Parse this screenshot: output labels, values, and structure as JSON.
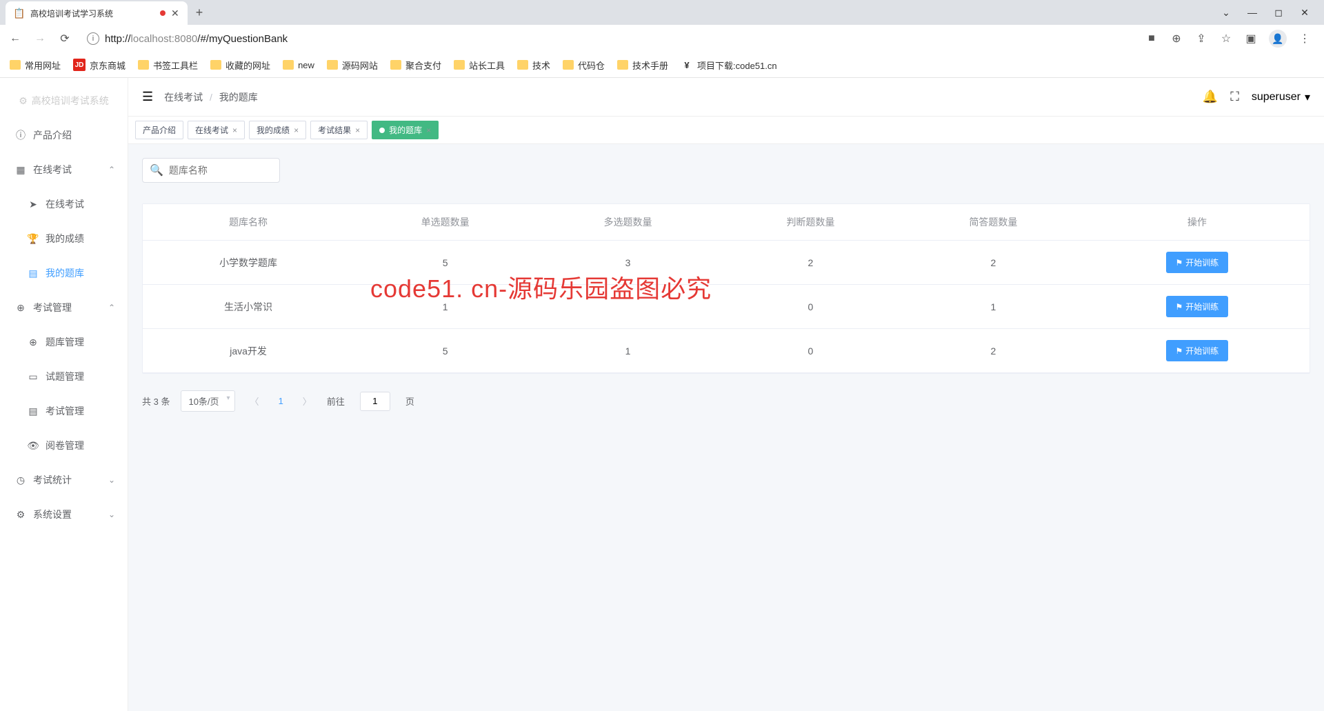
{
  "browser": {
    "tab_title": "高校培训考试学习系统",
    "url_host": "localhost",
    "url_port": ":8080",
    "url_path": "/#/myQuestionBank",
    "url_display_prefix": "http://"
  },
  "bookmarks": [
    {
      "label": "常用网址",
      "type": "folder"
    },
    {
      "label": "京东商城",
      "type": "jd"
    },
    {
      "label": "书签工具栏",
      "type": "folder"
    },
    {
      "label": "收藏的网址",
      "type": "folder"
    },
    {
      "label": "new",
      "type": "folder"
    },
    {
      "label": "源码网站",
      "type": "folder"
    },
    {
      "label": "聚合支付",
      "type": "folder"
    },
    {
      "label": "站长工具",
      "type": "folder"
    },
    {
      "label": "技术",
      "type": "folder"
    },
    {
      "label": "代码仓",
      "type": "folder"
    },
    {
      "label": "技术手册",
      "type": "folder"
    },
    {
      "label": "项目下载:code51.cn",
      "type": "yen"
    }
  ],
  "sidebar": {
    "logo": "高校培训考试系统",
    "items": [
      {
        "label": "产品介绍",
        "icon": "ⓘ"
      },
      {
        "label": "在线考试",
        "icon": "▦",
        "expandable": true,
        "open": true,
        "children": [
          {
            "label": "在线考试",
            "icon": "➤"
          },
          {
            "label": "我的成绩",
            "icon": "🏆"
          },
          {
            "label": "我的题库",
            "icon": "▤",
            "active": true
          }
        ]
      },
      {
        "label": "考试管理",
        "icon": "⊕",
        "expandable": true,
        "open": true,
        "children": [
          {
            "label": "题库管理",
            "icon": "⊕"
          },
          {
            "label": "试题管理",
            "icon": "▭"
          },
          {
            "label": "考试管理",
            "icon": "▤"
          },
          {
            "label": "阅卷管理",
            "icon": "👁"
          }
        ]
      },
      {
        "label": "考试统计",
        "icon": "◷",
        "expandable": true,
        "open": false
      },
      {
        "label": "系统设置",
        "icon": "⚙",
        "expandable": true,
        "open": false
      }
    ]
  },
  "topbar": {
    "breadcrumb": [
      "在线考试",
      "我的题库"
    ],
    "user": "superuser"
  },
  "page_tabs": [
    {
      "label": "产品介绍",
      "closable": false
    },
    {
      "label": "在线考试",
      "closable": true
    },
    {
      "label": "我的成绩",
      "closable": true
    },
    {
      "label": "考试结果",
      "closable": true
    },
    {
      "label": "我的题库",
      "closable": true,
      "active": true
    }
  ],
  "search": {
    "placeholder": "题库名称"
  },
  "table": {
    "headers": [
      "题库名称",
      "单选题数量",
      "多选题数量",
      "判断题数量",
      "简答题数量",
      "操作"
    ],
    "rows": [
      {
        "name": "小学数学题库",
        "single": "5",
        "multi": "3",
        "judge": "2",
        "short": "2"
      },
      {
        "name": "生活小常识",
        "single": "1",
        "multi": "",
        "judge": "0",
        "short": "1"
      },
      {
        "name": "java开发",
        "single": "5",
        "multi": "1",
        "judge": "0",
        "short": "2"
      }
    ],
    "action_label": "开始训练"
  },
  "watermark": "code51. cn-源码乐园盗图必究",
  "pagination": {
    "total_text": "共 3 条",
    "page_size": "10条/页",
    "current": "1",
    "goto_label_pre": "前往",
    "goto_value": "1",
    "goto_label_post": "页"
  }
}
